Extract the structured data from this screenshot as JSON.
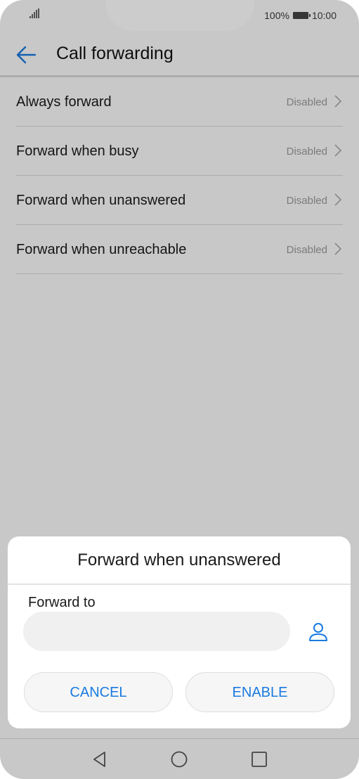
{
  "status_bar": {
    "battery": "100%",
    "time": "10:00"
  },
  "app_bar": {
    "title": "Call forwarding",
    "back_icon": "arrow-left-icon"
  },
  "list": [
    {
      "label": "Always forward",
      "status": "Disabled"
    },
    {
      "label": "Forward when busy",
      "status": "Disabled"
    },
    {
      "label": "Forward when unanswered",
      "status": "Disabled"
    },
    {
      "label": "Forward when unreachable",
      "status": "Disabled"
    }
  ],
  "dialog": {
    "title": "Forward when unanswered",
    "field_label": "Forward to",
    "input_value": "",
    "contact_icon": "person-icon",
    "cancel_label": "CANCEL",
    "enable_label": "ENABLE"
  },
  "colors": {
    "accent": "#1a7ae0",
    "scrim": "rgba(0,0,0,0.2)"
  },
  "nav_icons": [
    "back-triangle-icon",
    "home-circle-icon",
    "recents-square-icon"
  ]
}
